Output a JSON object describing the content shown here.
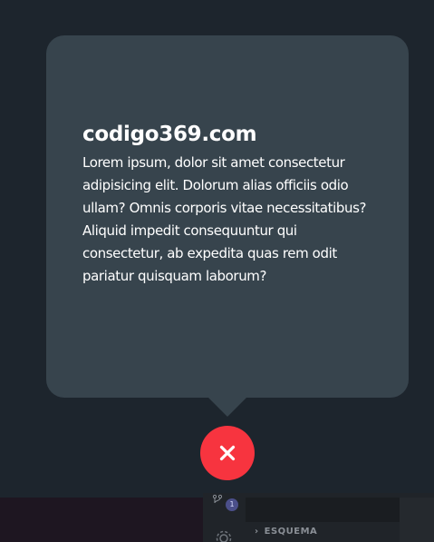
{
  "tooltip": {
    "title": "codigo369.com",
    "body": "Lorem ipsum, dolor sit amet consectetur adipisicing elit. Dolorum alias officiis odio ullam? Omnis corporis vitae necessitatibus? Aliquid impedit consequuntur qui consectetur, ab expedita quas rem odit pariatur quisquam laborum?"
  },
  "close_button": {
    "icon": "close-icon"
  },
  "background_app": {
    "badge_count": "1",
    "section_label": "ESQUEMA"
  },
  "colors": {
    "page_bg": "#1d252d",
    "card_bg": "#37444d",
    "text": "#ffffff",
    "close_bg": "#f7343f"
  }
}
